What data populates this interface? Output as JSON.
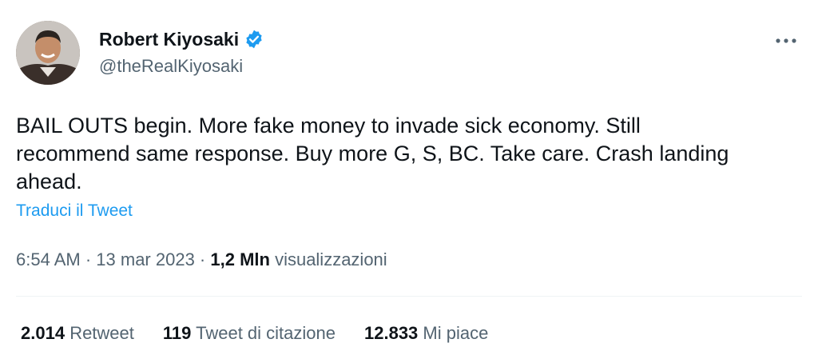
{
  "author": {
    "display_name": "Robert Kiyosaki",
    "handle": "@theRealKiyosaki",
    "verified_icon": "verified-badge-icon",
    "verified_color": "#1d9bf0"
  },
  "tweet": {
    "text": "BAIL OUTS begin. More fake money to invade sick economy. Still\nrecommend same response. Buy more G, S, BC. Take care. Crash landing\nahead.",
    "translate_label": "Traduci il Tweet"
  },
  "meta": {
    "time": "6:54 AM",
    "sep1": " · ",
    "date": "13 mar 2023",
    "sep2": " · ",
    "views_count": "1,2 Mln",
    "views_label": " visualizzazioni"
  },
  "stats": {
    "retweets_count": "2.014",
    "retweets_label": "Retweet",
    "quotes_count": "119",
    "quotes_label": "Tweet di citazione",
    "likes_count": "12.833",
    "likes_label": "Mi piace"
  },
  "colors": {
    "accent": "#1d9bf0",
    "text_primary": "#0f1419",
    "text_secondary": "#536471"
  }
}
